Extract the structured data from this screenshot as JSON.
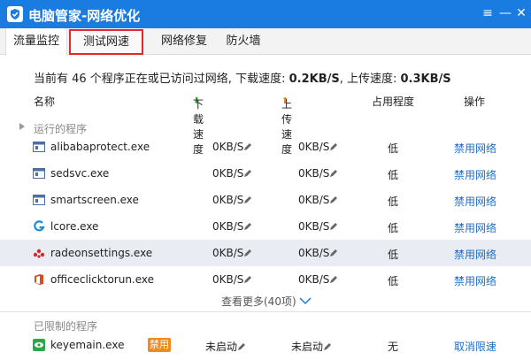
{
  "window": {
    "title": "电脑管家-网络优化",
    "menu_icon": "≡",
    "min_icon": "—",
    "close_icon": "✕"
  },
  "tabs": [
    {
      "label": "流量监控"
    },
    {
      "label": "测试网速"
    },
    {
      "label": "网络修复"
    },
    {
      "label": "防火墙"
    }
  ],
  "summary": {
    "prefix": "当前有 46 个程序正在或已访问过网络, 下载速度: ",
    "download": "0.2KB/S",
    "middle": ", 上传速度: ",
    "upload": "0.3KB/S"
  },
  "columns": {
    "name": "名称",
    "download": "下载速度",
    "upload": "上传速度",
    "occupancy": "占用程度",
    "action": "操作"
  },
  "running_section": "运行的程序",
  "running": [
    {
      "name": "alibabaprotect.exe",
      "down": "0KB/S",
      "up": "0KB/S",
      "occ": "低",
      "action": "禁用网络",
      "icon": "window-app-icon"
    },
    {
      "name": "sedsvc.exe",
      "down": "0KB/S",
      "up": "0KB/S",
      "occ": "低",
      "action": "禁用网络",
      "icon": "window-app-icon"
    },
    {
      "name": "smartscreen.exe",
      "down": "0KB/S",
      "up": "0KB/S",
      "occ": "低",
      "action": "禁用网络",
      "icon": "window-app-icon"
    },
    {
      "name": "lcore.exe",
      "down": "0KB/S",
      "up": "0KB/S",
      "occ": "低",
      "action": "禁用网络",
      "icon": "logitech-g-icon"
    },
    {
      "name": "radeonsettings.exe",
      "down": "0KB/S",
      "up": "0KB/S",
      "occ": "低",
      "action": "禁用网络",
      "icon": "radeon-icon"
    },
    {
      "name": "officeclicktorun.exe",
      "down": "0KB/S",
      "up": "0KB/S",
      "occ": "低",
      "action": "禁用网络",
      "icon": "office-icon"
    }
  ],
  "more_label": "查看更多(40项)",
  "restricted_section": "已限制的程序",
  "restricted": [
    {
      "name": "keyemain.exe",
      "badge": "禁用",
      "down": "未启动",
      "up": "未启动",
      "occ": "无",
      "action": "取消限速",
      "icon": "eye-app-icon"
    }
  ],
  "colors": {
    "titlebar": "#1a7be0",
    "link": "#1a6fc7",
    "badge": "#f08a1c",
    "active_tab_border": "#e02a2a"
  }
}
